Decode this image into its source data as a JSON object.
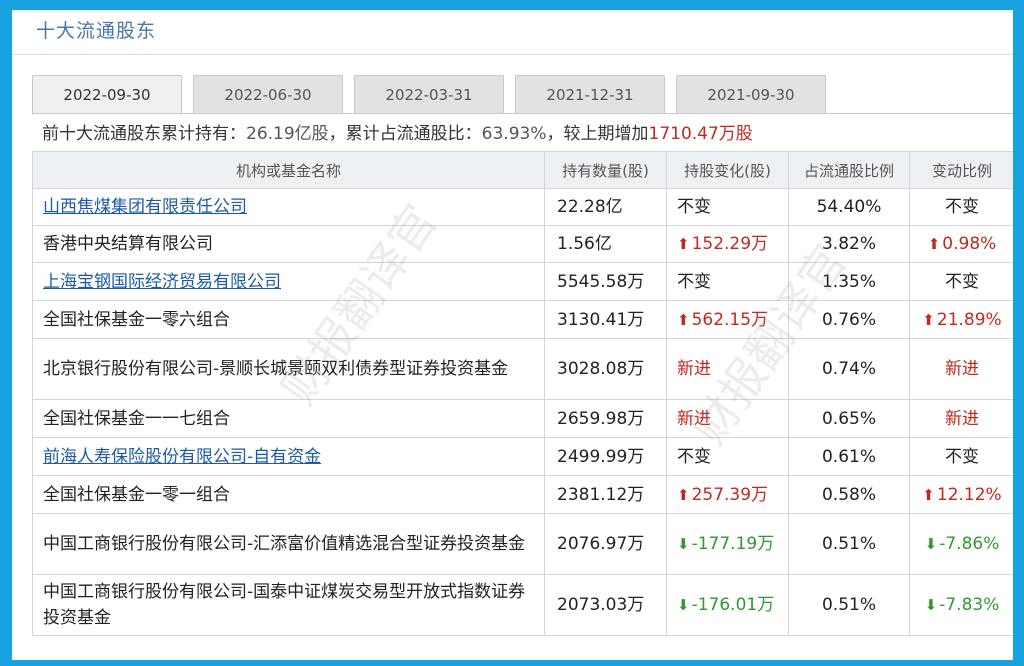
{
  "title": "十大流通股东",
  "tabs": [
    "2022-09-30",
    "2022-06-30",
    "2022-03-31",
    "2021-12-31",
    "2021-09-30"
  ],
  "active_tab": "2022-09-30",
  "summary": {
    "prefix": "前十大流通股东累计持有：",
    "held": "26.19亿股",
    "mid": "，累计占流通股比：",
    "ratio": "63.93%",
    "mid2": "，较上期增加",
    "increase": "1710.47万股"
  },
  "table": {
    "headers": [
      "机构或基金名称",
      "持有数量(股)",
      "持股变化(股)",
      "占流通股比例",
      "变动比例"
    ],
    "rows": [
      {
        "name": "山西焦煤集团有限责任公司",
        "link": true,
        "hold": "22.28亿",
        "change": "不变",
        "change_dir": "none",
        "ratio": "54.40%",
        "var": "不变",
        "var_dir": "none"
      },
      {
        "name": "香港中央结算有限公司",
        "link": false,
        "hold": "1.56亿",
        "change": "152.29万",
        "change_dir": "up",
        "ratio": "3.82%",
        "var": "0.98%",
        "var_dir": "up"
      },
      {
        "name": "上海宝钢国际经济贸易有限公司",
        "link": true,
        "hold": "5545.58万",
        "change": "不变",
        "change_dir": "none",
        "ratio": "1.35%",
        "var": "不变",
        "var_dir": "none"
      },
      {
        "name": "全国社保基金一零六组合",
        "link": false,
        "hold": "3130.41万",
        "change": "562.15万",
        "change_dir": "up",
        "ratio": "0.76%",
        "var": "21.89%",
        "var_dir": "up"
      },
      {
        "name": "北京银行股份有限公司-景顺长城景颐双利债券型证券投资基金",
        "link": false,
        "hold": "3028.08万",
        "change": "新进",
        "change_dir": "new",
        "ratio": "0.74%",
        "var": "新进",
        "var_dir": "new"
      },
      {
        "name": "全国社保基金一一七组合",
        "link": false,
        "hold": "2659.98万",
        "change": "新进",
        "change_dir": "new",
        "ratio": "0.65%",
        "var": "新进",
        "var_dir": "new"
      },
      {
        "name": "前海人寿保险股份有限公司-自有资金",
        "link": true,
        "hold": "2499.99万",
        "change": "不变",
        "change_dir": "none",
        "ratio": "0.61%",
        "var": "不变",
        "var_dir": "none"
      },
      {
        "name": "全国社保基金一零一组合",
        "link": false,
        "hold": "2381.12万",
        "change": "257.39万",
        "change_dir": "up",
        "ratio": "0.58%",
        "var": "12.12%",
        "var_dir": "up"
      },
      {
        "name": "中国工商银行股份有限公司-汇添富价值精选混合型证券投资基金",
        "link": false,
        "hold": "2076.97万",
        "change": "-177.19万",
        "change_dir": "down",
        "ratio": "0.51%",
        "var": "-7.86%",
        "var_dir": "down"
      },
      {
        "name": "中国工商银行股份有限公司-国泰中证煤炭交易型开放式指数证券投资基金",
        "link": false,
        "hold": "2073.03万",
        "change": "-176.01万",
        "change_dir": "down",
        "ratio": "0.51%",
        "var": "-7.83%",
        "var_dir": "down"
      }
    ]
  },
  "watermark": "财报翻译官",
  "colors": {
    "up": "#c2281f",
    "down": "#2f9a2f",
    "link": "#1c5aa6",
    "frame": "#17a3df"
  }
}
